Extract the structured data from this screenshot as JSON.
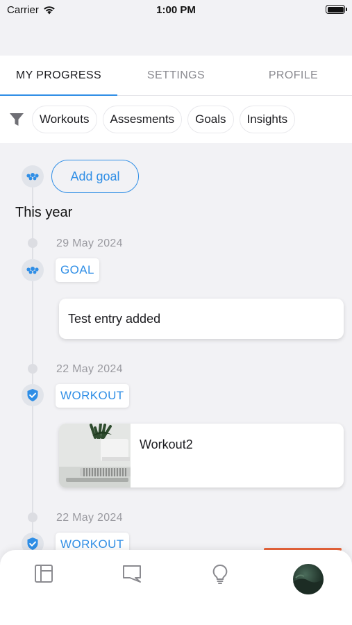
{
  "status_bar": {
    "carrier": "Carrier",
    "time": "1:00 PM"
  },
  "tabs": [
    {
      "label": "MY PROGRESS",
      "active": true
    },
    {
      "label": "SETTINGS",
      "active": false
    },
    {
      "label": "PROFILE",
      "active": false
    }
  ],
  "filters": {
    "icon": "filter-icon",
    "chips": [
      "Workouts",
      "Assesments",
      "Goals",
      "Insights"
    ]
  },
  "timeline": {
    "add_goal_label": "Add goal",
    "section_title": "This year",
    "entries": [
      {
        "date": "29 May 2024",
        "tag": "GOAL",
        "icon": "goal-icon",
        "text": "Test entry added"
      },
      {
        "date": "22 May 2024",
        "tag": "WORKOUT",
        "icon": "shield-check-icon",
        "text": "Workout2"
      },
      {
        "date": "22 May 2024",
        "tag": "WORKOUT",
        "icon": "shield-check-icon"
      }
    ]
  },
  "bottom_nav": [
    {
      "icon": "dashboard-icon"
    },
    {
      "icon": "chat-icon"
    },
    {
      "icon": "lightbulb-icon"
    },
    {
      "icon": "avatar"
    }
  ],
  "colors": {
    "accent": "#2f8ee6",
    "background": "#f2f2f5",
    "highlight": "#e8643a"
  }
}
